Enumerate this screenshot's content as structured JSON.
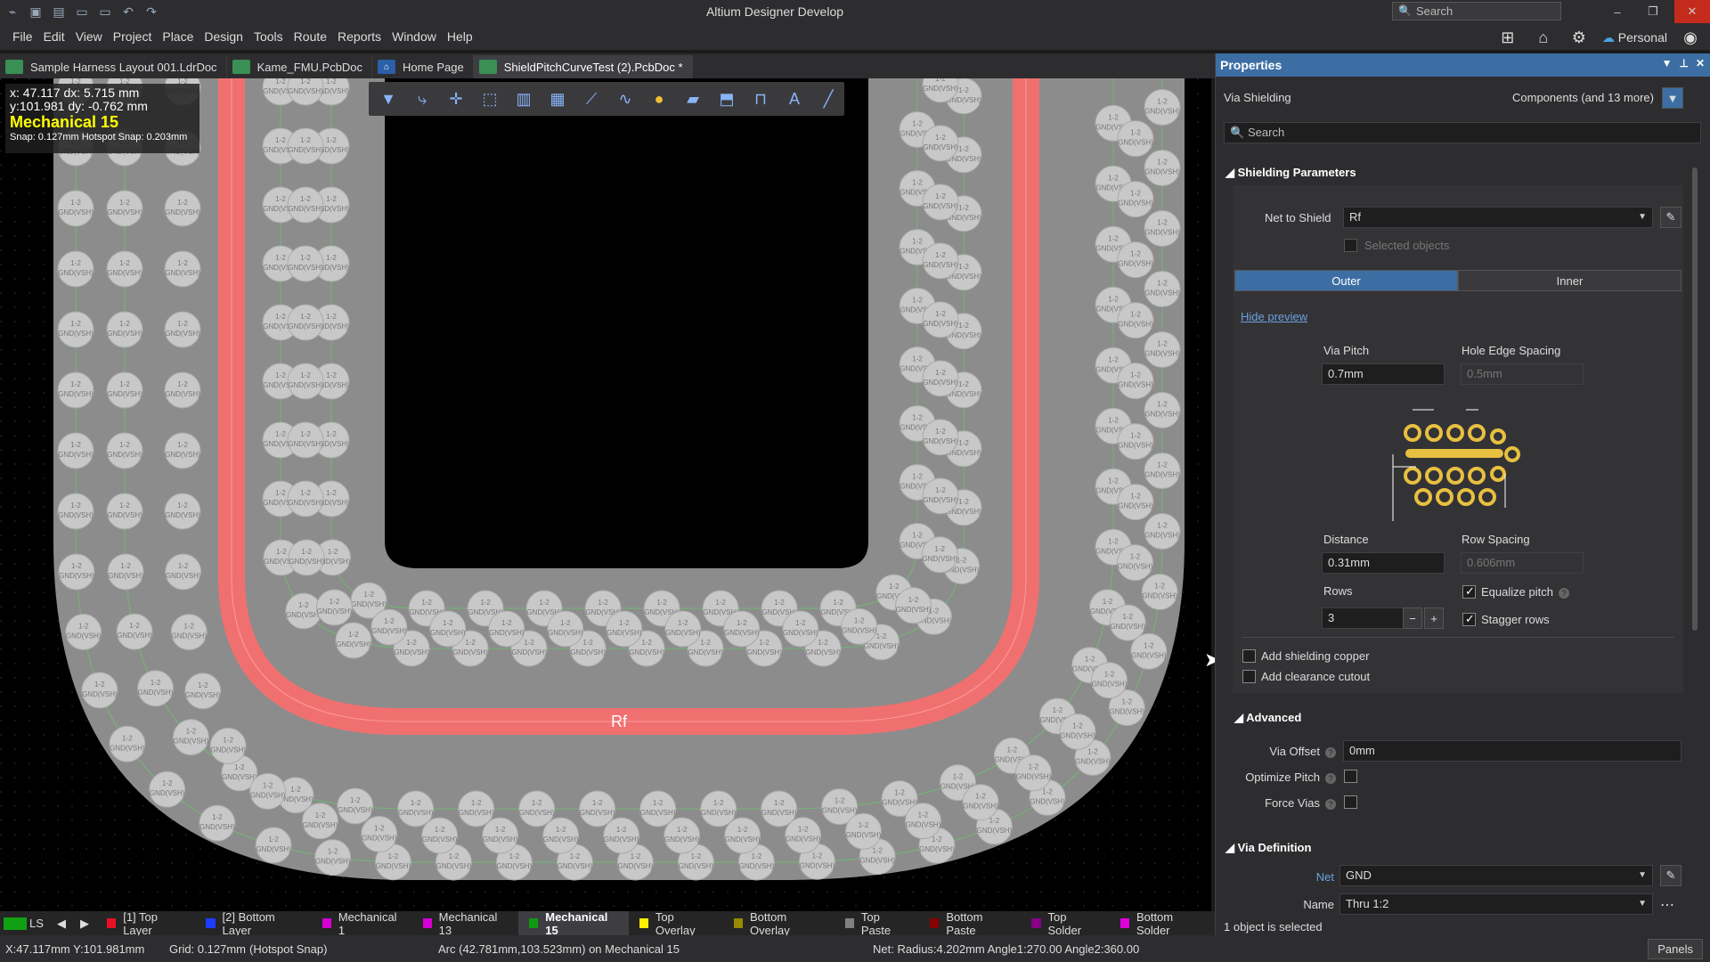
{
  "window": {
    "title": "Altium Designer Develop",
    "search_placeholder": "Search"
  },
  "menu": [
    "File",
    "Edit",
    "View",
    "Project",
    "Place",
    "Design",
    "Tools",
    "Route",
    "Reports",
    "Window",
    "Help"
  ],
  "right_tools": {
    "account": "Personal"
  },
  "tabs": [
    {
      "label": "Sample Harness Layout 001.LdrDoc",
      "active": false
    },
    {
      "label": "Kame_FMU.PcbDoc",
      "active": false
    },
    {
      "label": "Home Page",
      "active": false
    },
    {
      "label": "ShieldPitchCurveTest (2).PcbDoc *",
      "active": true
    }
  ],
  "hud": {
    "line1": "x: 47.117    dx: 5.715 mm",
    "line2": "y:101.981   dy: -0.762 mm",
    "layer": "Mechanical 15",
    "snap": "Snap: 0.127mm Hotspot Snap: 0.203mm"
  },
  "canvas": {
    "net_label": "Rf",
    "via_label": "GND(VSH)",
    "via_top": "1-2"
  },
  "layers": [
    {
      "label": "[1] Top Layer",
      "color": "#e81123"
    },
    {
      "label": "[2] Bottom Layer",
      "color": "#1e3cff"
    },
    {
      "label": "Mechanical 1",
      "color": "#d400d4"
    },
    {
      "label": "Mechanical 13",
      "color": "#d400d4"
    },
    {
      "label": "Mechanical 15",
      "color": "#119911",
      "active": true
    },
    {
      "label": "Top Overlay",
      "color": "#ffee00"
    },
    {
      "label": "Bottom Overlay",
      "color": "#998800"
    },
    {
      "label": "Top Paste",
      "color": "#808080"
    },
    {
      "label": "Bottom Paste",
      "color": "#880000"
    },
    {
      "label": "Top Solder",
      "color": "#880088"
    },
    {
      "label": "Bottom Solder",
      "color": "#dd00dd"
    }
  ],
  "layer_ls": "LS",
  "status": {
    "coords": "X:47.117mm Y:101.981mm",
    "grid": "Grid: 0.127mm",
    "snap": "(Hotspot Snap)",
    "arc": "Arc (42.781mm,103.523mm) on Mechanical 15",
    "net": "Net:  Radius:4.202mm Angle1:270.00 Angle2:360.00",
    "panels": "Panels"
  },
  "properties": {
    "title": "Properties",
    "object_type": "Via Shielding",
    "filter_text": "Components (and 13 more)",
    "search_placeholder": "Search",
    "shielding": {
      "section": "Shielding Parameters",
      "net_label": "Net to Shield",
      "net_value": "Rf",
      "selected_objects": "Selected objects",
      "outer": "Outer",
      "inner": "Inner",
      "hide_preview": "Hide preview",
      "via_pitch_label": "Via Pitch",
      "via_pitch": "0.7mm",
      "hole_edge_label": "Hole Edge Spacing",
      "hole_edge": "0.5mm",
      "distance_label": "Distance",
      "distance": "0.31mm",
      "row_spacing_label": "Row Spacing",
      "row_spacing": "0.606mm",
      "rows_label": "Rows",
      "rows": "3",
      "equalize_pitch": "Equalize pitch",
      "stagger_rows": "Stagger rows",
      "add_shielding_copper": "Add shielding copper",
      "add_clearance_cutout": "Add clearance cutout"
    },
    "advanced": {
      "section": "Advanced",
      "via_offset_label": "Via Offset",
      "via_offset": "0mm",
      "optimize_pitch_label": "Optimize Pitch",
      "force_vias_label": "Force Vias"
    },
    "via_def": {
      "section": "Via Definition",
      "net_label": "Net",
      "net_value": "GND",
      "name_label": "Name",
      "name_value": "Thru 1:2"
    },
    "footer": "1 object is selected"
  }
}
